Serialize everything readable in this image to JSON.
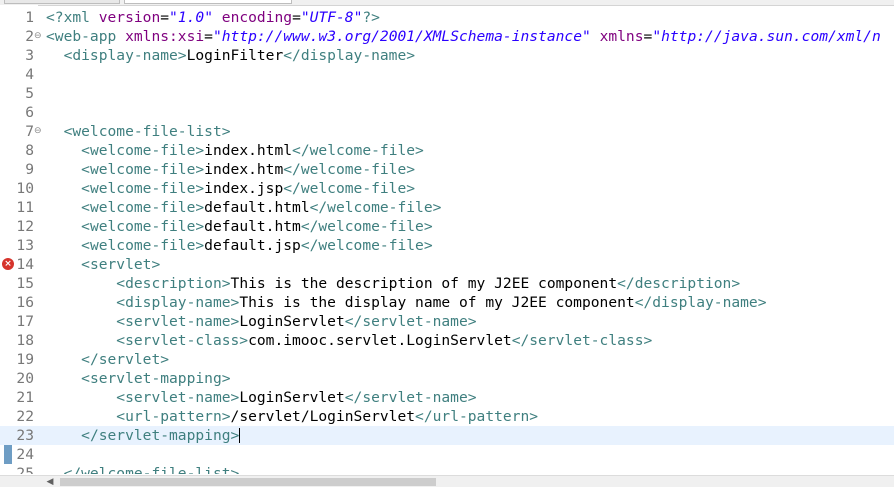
{
  "tabs": [
    "",
    ""
  ],
  "icons": {
    "error": "error-icon",
    "fold": "fold-icon",
    "scroll_left": "chevron-left-icon"
  },
  "current_line": 23,
  "error_line": 14,
  "lines": [
    {
      "n": "1",
      "segs": [
        [
          "t",
          "<?"
        ],
        [
          "t",
          "xml"
        ],
        [
          "x",
          " "
        ],
        [
          "a",
          "version"
        ],
        [
          "x",
          "="
        ],
        [
          "v",
          "\"1.0\""
        ],
        [
          "x",
          " "
        ],
        [
          "a",
          "encoding"
        ],
        [
          "x",
          "="
        ],
        [
          "v",
          "\"UTF-8\""
        ],
        [
          "t",
          "?>"
        ]
      ]
    },
    {
      "n": "2",
      "fold": "⊖",
      "segs": [
        [
          "t",
          "<web-app"
        ],
        [
          "x",
          " "
        ],
        [
          "a",
          "xmlns:xsi"
        ],
        [
          "x",
          "="
        ],
        [
          "v",
          "\"http://www.w3.org/2001/XMLSchema-instance\""
        ],
        [
          "x",
          " "
        ],
        [
          "a",
          "xmlns"
        ],
        [
          "x",
          "="
        ],
        [
          "v",
          "\"http://java.sun.com/xml/n"
        ]
      ]
    },
    {
      "n": "3",
      "segs": [
        [
          "x",
          "  "
        ],
        [
          "t",
          "<display-name>"
        ],
        [
          "x",
          "LoginFilter"
        ],
        [
          "t",
          "</display-name>"
        ]
      ]
    },
    {
      "n": "4",
      "segs": []
    },
    {
      "n": "5",
      "segs": []
    },
    {
      "n": "6",
      "segs": []
    },
    {
      "n": "7",
      "fold": "⊖",
      "segs": [
        [
          "x",
          "  "
        ],
        [
          "t",
          "<welcome-file-list>"
        ]
      ]
    },
    {
      "n": "8",
      "segs": [
        [
          "x",
          "    "
        ],
        [
          "t",
          "<welcome-file>"
        ],
        [
          "x",
          "index.html"
        ],
        [
          "t",
          "</welcome-file>"
        ]
      ]
    },
    {
      "n": "9",
      "segs": [
        [
          "x",
          "    "
        ],
        [
          "t",
          "<welcome-file>"
        ],
        [
          "x",
          "index.htm"
        ],
        [
          "t",
          "</welcome-file>"
        ]
      ]
    },
    {
      "n": "10",
      "segs": [
        [
          "x",
          "    "
        ],
        [
          "t",
          "<welcome-file>"
        ],
        [
          "x",
          "index.jsp"
        ],
        [
          "t",
          "</welcome-file>"
        ]
      ]
    },
    {
      "n": "11",
      "segs": [
        [
          "x",
          "    "
        ],
        [
          "t",
          "<welcome-file>"
        ],
        [
          "x",
          "default.html"
        ],
        [
          "t",
          "</welcome-file>"
        ]
      ]
    },
    {
      "n": "12",
      "segs": [
        [
          "x",
          "    "
        ],
        [
          "t",
          "<welcome-file>"
        ],
        [
          "x",
          "default.htm"
        ],
        [
          "t",
          "</welcome-file>"
        ]
      ]
    },
    {
      "n": "13",
      "segs": [
        [
          "x",
          "    "
        ],
        [
          "t",
          "<welcome-file>"
        ],
        [
          "x",
          "default.jsp"
        ],
        [
          "t",
          "</welcome-file>"
        ]
      ]
    },
    {
      "n": "14",
      "segs": [
        [
          "x",
          "    "
        ],
        [
          "t",
          "<servlet>"
        ]
      ]
    },
    {
      "n": "15",
      "segs": [
        [
          "x",
          "        "
        ],
        [
          "t",
          "<description>"
        ],
        [
          "x",
          "This is the description of my J2EE component"
        ],
        [
          "t",
          "</description>"
        ]
      ]
    },
    {
      "n": "16",
      "segs": [
        [
          "x",
          "        "
        ],
        [
          "t",
          "<display-name>"
        ],
        [
          "x",
          "This is the display name of my J2EE component"
        ],
        [
          "t",
          "</display-name>"
        ]
      ]
    },
    {
      "n": "17",
      "segs": [
        [
          "x",
          "        "
        ],
        [
          "t",
          "<servlet-name>"
        ],
        [
          "x",
          "LoginServlet"
        ],
        [
          "t",
          "</servlet-name>"
        ]
      ]
    },
    {
      "n": "18",
      "segs": [
        [
          "x",
          "        "
        ],
        [
          "t",
          "<servlet-class>"
        ],
        [
          "x",
          "com.imooc.servlet.LoginServlet"
        ],
        [
          "t",
          "</servlet-class>"
        ]
      ]
    },
    {
      "n": "19",
      "segs": [
        [
          "x",
          "    "
        ],
        [
          "t",
          "</servlet>"
        ]
      ]
    },
    {
      "n": "20",
      "segs": [
        [
          "x",
          "    "
        ],
        [
          "t",
          "<servlet-mapping>"
        ]
      ]
    },
    {
      "n": "21",
      "segs": [
        [
          "x",
          "        "
        ],
        [
          "t",
          "<servlet-name>"
        ],
        [
          "x",
          "LoginServlet"
        ],
        [
          "t",
          "</servlet-name>"
        ]
      ]
    },
    {
      "n": "22",
      "segs": [
        [
          "x",
          "        "
        ],
        [
          "t",
          "<url-pattern>"
        ],
        [
          "x",
          "/servlet/LoginServlet"
        ],
        [
          "t",
          "</url-pattern>"
        ]
      ]
    },
    {
      "n": "23",
      "segs": [
        [
          "x",
          "    "
        ],
        [
          "t",
          "</servlet-mapping>"
        ]
      ],
      "caret": true
    },
    {
      "n": "24",
      "segs": []
    },
    {
      "n": "25",
      "segs": [
        [
          "x",
          "  "
        ],
        [
          "t",
          "</welcome-file-list>"
        ]
      ]
    }
  ]
}
